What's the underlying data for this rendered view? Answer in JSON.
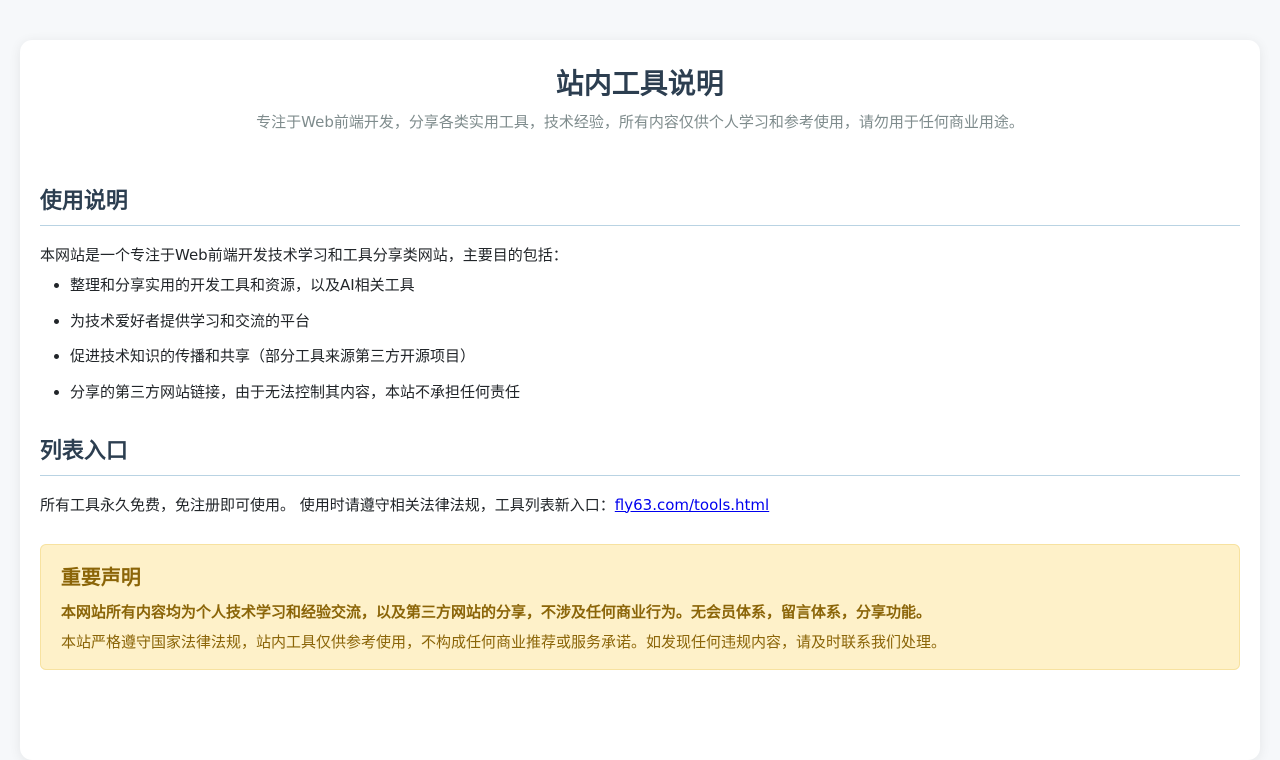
{
  "header": {
    "title": "站内工具说明",
    "subtitle": "专注于Web前端开发，分享各类实用工具，技术经验，所有内容仅供个人学习和参考使用，请勿用于任何商业用途。"
  },
  "usage": {
    "title": "使用说明",
    "intro": "本网站是一个专注于Web前端开发技术学习和工具分享类网站，主要目的包括：",
    "items": [
      "整理和分享实用的开发工具和资源，以及AI相关工具",
      "为技术爱好者提供学习和交流的平台",
      "促进技术知识的传播和共享（部分工具来源第三方开源项目）",
      "分享的第三方网站链接，由于无法控制其内容，本站不承担任何责任"
    ]
  },
  "list_entry": {
    "title": "列表入口",
    "text": "所有工具永久免费，免注册即可使用。 使用时请遵守相关法律法规，工具列表新入口：",
    "link_label": "fly63.com/tools.html"
  },
  "notice": {
    "title": "重要声明",
    "strong": "本网站所有内容均为个人技术学习和经验交流，以及第三方网站的分享，不涉及任何商业行为。无会员体系，留言体系，分享功能。",
    "text": "本站严格遵守国家法律法规，站内工具仅供参考使用，不构成任何商业推荐或服务承诺。如发现任何违规内容，请及时联系我们处理。"
  },
  "colors": {
    "heading": "#2c3e50",
    "notice_bg": "#fef1c9",
    "notice_text": "#8b6508",
    "link": "#0000ee"
  }
}
